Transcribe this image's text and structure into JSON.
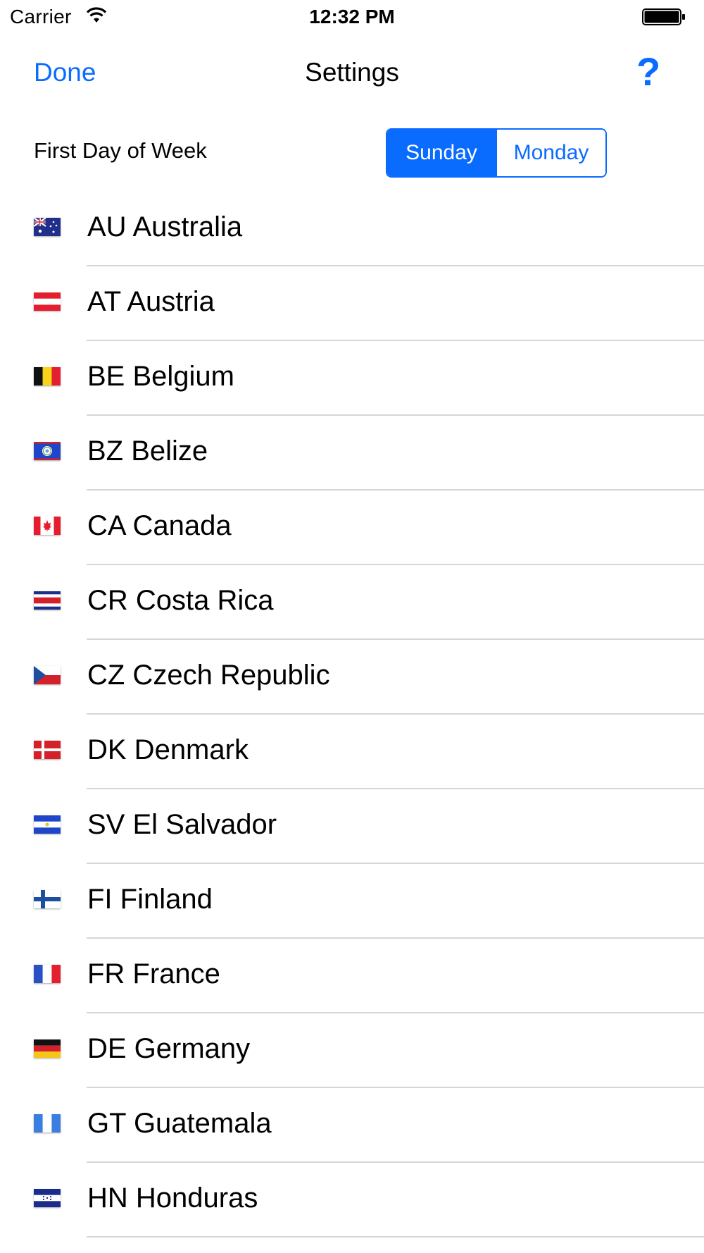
{
  "status_bar": {
    "carrier": "Carrier",
    "time": "12:32 PM",
    "wifi_icon": "wifi-icon",
    "battery_icon": "battery-icon"
  },
  "nav": {
    "done_label": "Done",
    "title": "Settings",
    "help_label": "?"
  },
  "week": {
    "label": "First Day of Week",
    "options": [
      "Sunday",
      "Monday"
    ],
    "selected": "Sunday"
  },
  "accent_color": "#0a6bff",
  "countries": [
    {
      "label": "AU Australia",
      "flag": "au-flag-icon"
    },
    {
      "label": "AT Austria",
      "flag": "at-flag-icon"
    },
    {
      "label": "BE Belgium",
      "flag": "be-flag-icon"
    },
    {
      "label": "BZ Belize",
      "flag": "bz-flag-icon"
    },
    {
      "label": "CA Canada",
      "flag": "ca-flag-icon"
    },
    {
      "label": "CR Costa Rica",
      "flag": "cr-flag-icon"
    },
    {
      "label": "CZ Czech Republic",
      "flag": "cz-flag-icon"
    },
    {
      "label": "DK Denmark",
      "flag": "dk-flag-icon"
    },
    {
      "label": "SV El Salvador",
      "flag": "sv-flag-icon"
    },
    {
      "label": "FI Finland",
      "flag": "fi-flag-icon"
    },
    {
      "label": "FR France",
      "flag": "fr-flag-icon"
    },
    {
      "label": "DE Germany",
      "flag": "de-flag-icon"
    },
    {
      "label": "GT Guatemala",
      "flag": "gt-flag-icon"
    },
    {
      "label": "HN Honduras",
      "flag": "hn-flag-icon"
    }
  ]
}
